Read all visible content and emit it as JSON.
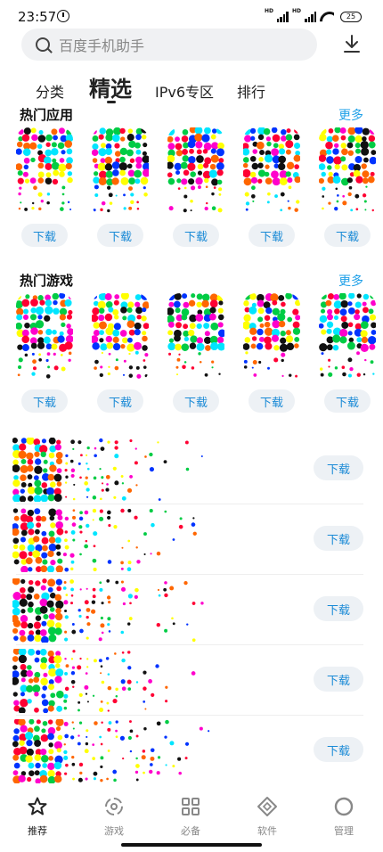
{
  "status_bar": {
    "time": "23:57",
    "network_label_1": "HD",
    "network_label_2": "HD",
    "battery": "25"
  },
  "search": {
    "placeholder": "百度手机助手"
  },
  "tabs": [
    {
      "label": "分类",
      "active": false
    },
    {
      "label": "精选",
      "active": true
    },
    {
      "label": "IPv6专区",
      "active": false
    },
    {
      "label": "排行",
      "active": false
    }
  ],
  "hot_apps": {
    "title": "热门应用",
    "more": "更多",
    "items": [
      {
        "button": "下载"
      },
      {
        "button": "下载"
      },
      {
        "button": "下载"
      },
      {
        "button": "下载"
      },
      {
        "button": "下载"
      }
    ]
  },
  "hot_games": {
    "title": "热门游戏",
    "more": "更多",
    "items": [
      {
        "button": "下载"
      },
      {
        "button": "下载"
      },
      {
        "button": "下载"
      },
      {
        "button": "下载"
      },
      {
        "button": "下载"
      }
    ]
  },
  "list_items": [
    {
      "button": "下载"
    },
    {
      "button": "下载"
    },
    {
      "button": "下载"
    },
    {
      "button": "下载"
    },
    {
      "button": "下载"
    }
  ],
  "bottom_nav": [
    {
      "label": "推荐",
      "icon": "star-icon",
      "active": true
    },
    {
      "label": "游戏",
      "icon": "gamepad-icon",
      "active": false
    },
    {
      "label": "必备",
      "icon": "grid-icon",
      "active": false
    },
    {
      "label": "软件",
      "icon": "diamond-icon",
      "active": false
    },
    {
      "label": "管理",
      "icon": "ring-icon",
      "active": false
    }
  ],
  "colors": {
    "accent": "#1fa0e8",
    "button_bg": "#edf1f5",
    "dot_palette": [
      "#ff0033",
      "#ff00cc",
      "#00e5ff",
      "#ffff00",
      "#0033ff",
      "#00cc44",
      "#111111",
      "#ff6600"
    ]
  }
}
